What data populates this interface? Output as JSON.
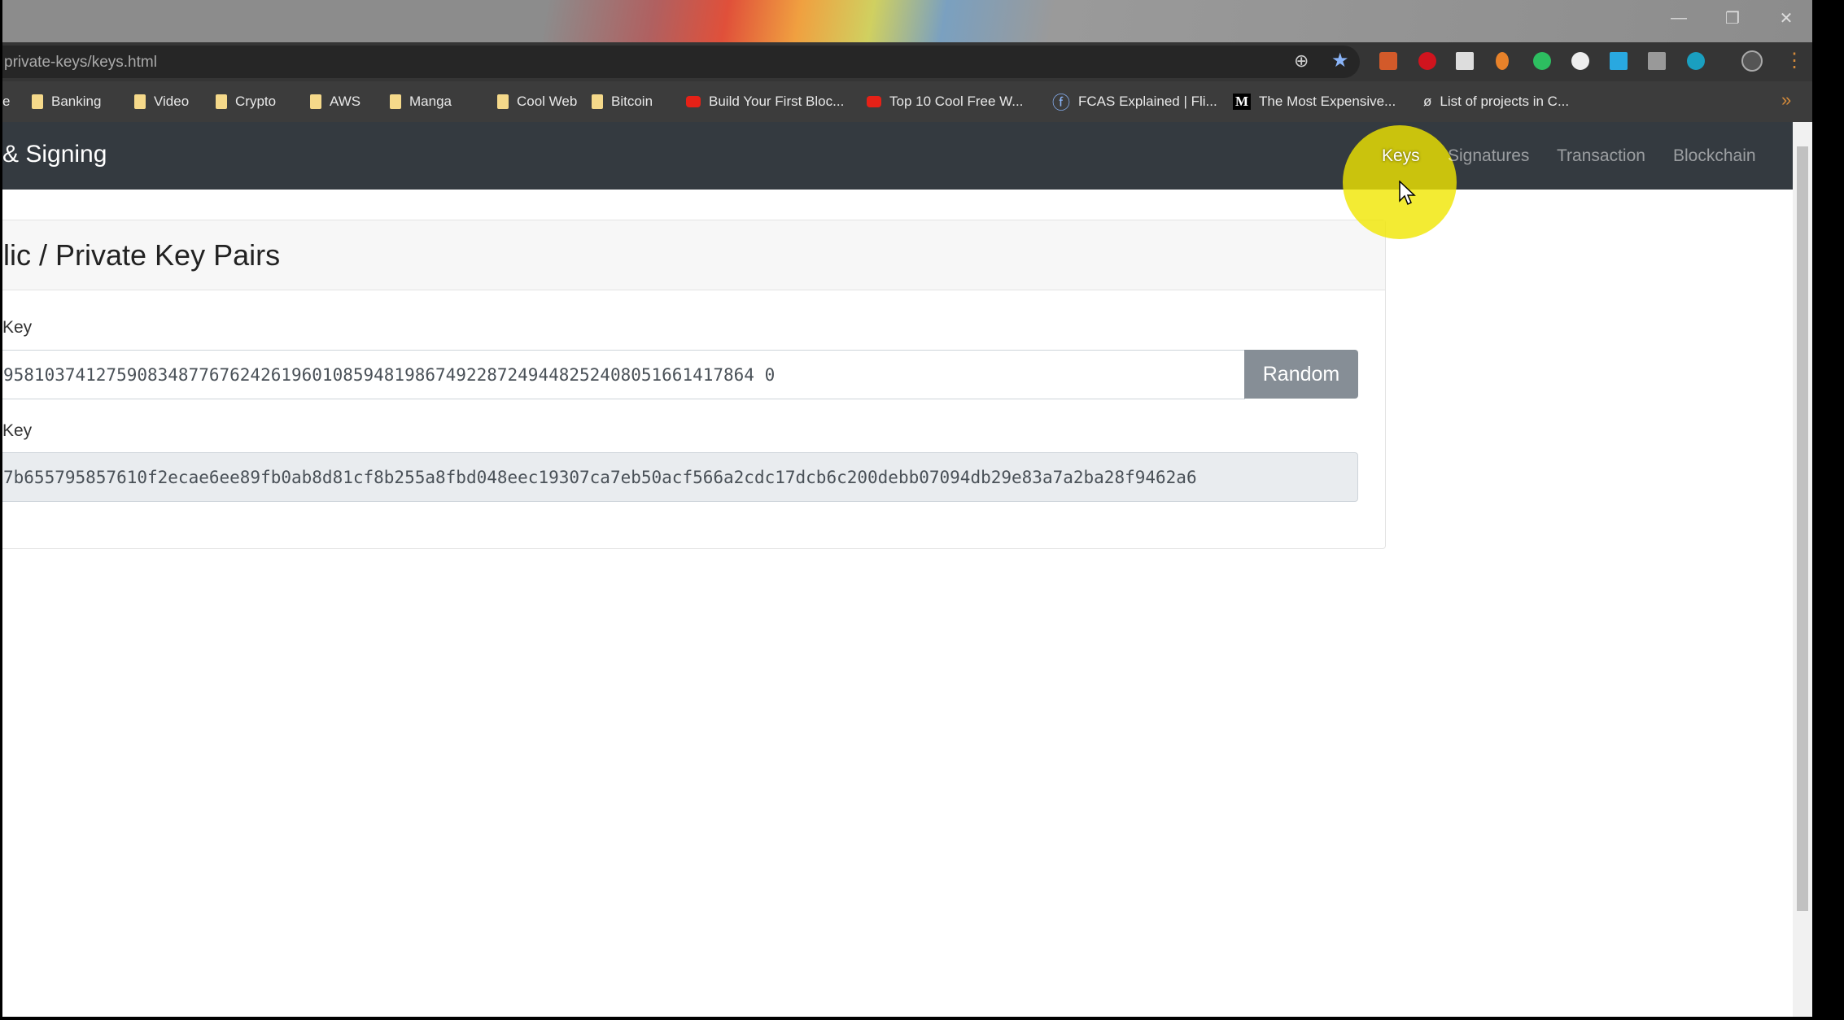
{
  "browser": {
    "url": "private-keys/keys.html",
    "bookmarks": [
      {
        "label": "e",
        "icon": "none"
      },
      {
        "label": "Banking",
        "icon": "folder-icon"
      },
      {
        "label": "Video",
        "icon": "folder-icon"
      },
      {
        "label": "Crypto",
        "icon": "folder-icon"
      },
      {
        "label": "AWS",
        "icon": "folder-icon"
      },
      {
        "label": "Manga",
        "icon": "folder-icon"
      },
      {
        "label": "Cool Web",
        "icon": "folder-icon"
      },
      {
        "label": "Bitcoin",
        "icon": "folder-icon"
      },
      {
        "label": "Build Your First Bloc...",
        "icon": "youtube-icon"
      },
      {
        "label": "Top 10 Cool Free W...",
        "icon": "youtube-icon"
      },
      {
        "label": "FCAS Explained | Fli...",
        "icon": "flipside-icon"
      },
      {
        "label": "The Most Expensive...",
        "icon": "medium-icon"
      },
      {
        "label": "List of projects in C...",
        "icon": "null-icon"
      }
    ],
    "overflow": "»",
    "more_menu": "⋮"
  },
  "navbar": {
    "brand": "& Signing",
    "links": [
      "Keys",
      "Signatures",
      "Transaction",
      "Blockchain"
    ],
    "active": "Keys"
  },
  "card": {
    "title": "lic / Private Key Pairs",
    "private_label": " Key",
    "private_value": "9581037412759083487767624261960108594819867492287249448252408051661417864 0",
    "random_label": "Random",
    "public_label": "Key",
    "public_value": "7b655795857610f2ecae6ee89fb0ab8d81cf8b255a8fbd048eec19307ca7eb50acf566a2cdc17dcb6c200debb07094db29e83a7a2ba28f9462a6"
  },
  "colors": {
    "navbar": "#343a40",
    "highlight": "#f0e600",
    "button": "#868e96"
  }
}
